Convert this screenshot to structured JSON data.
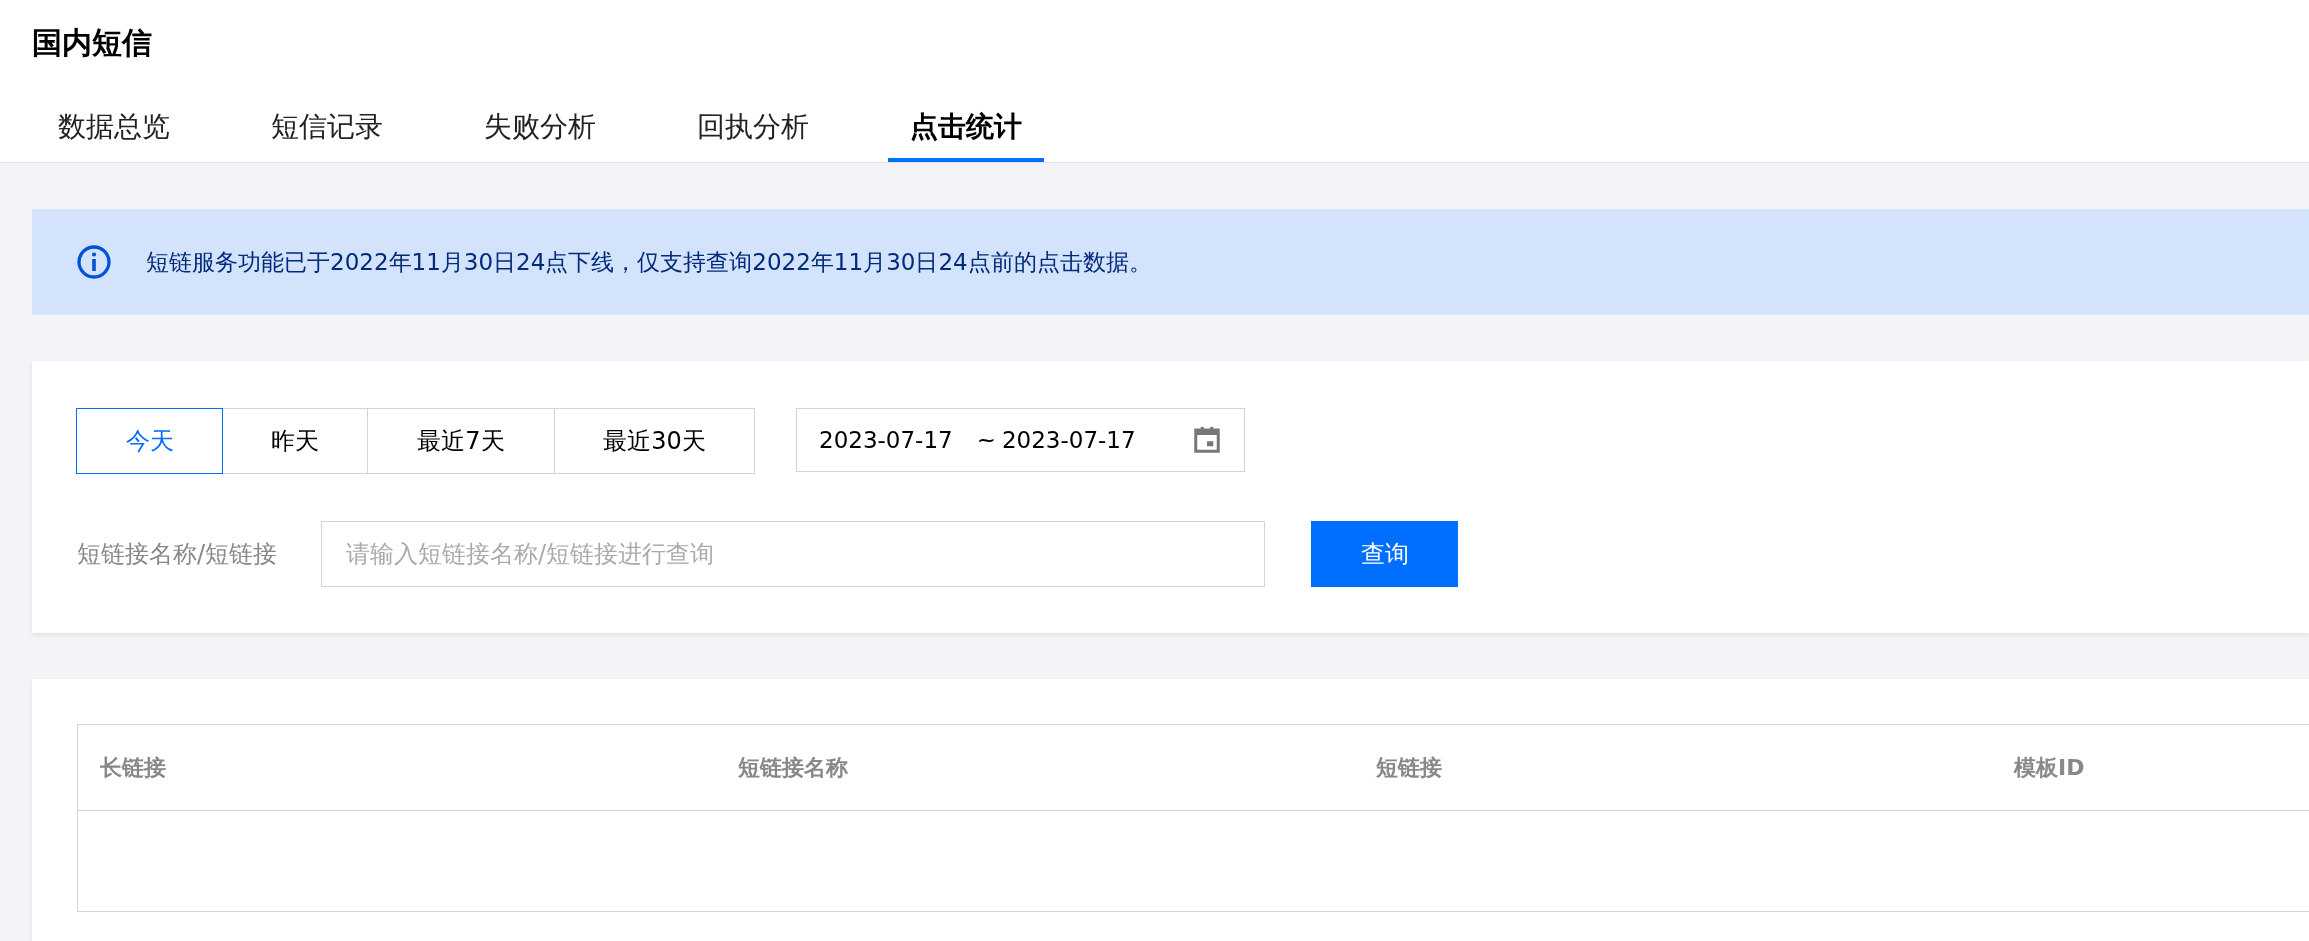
{
  "page": {
    "title": "国内短信"
  },
  "tabs": [
    {
      "label": "数据总览",
      "selected": false
    },
    {
      "label": "短信记录",
      "selected": false
    },
    {
      "label": "失败分析",
      "selected": false
    },
    {
      "label": "回执分析",
      "selected": false
    },
    {
      "label": "点击统计",
      "selected": true
    }
  ],
  "notice": {
    "text": "短链服务功能已于2022年11月30日24点下线，仅支持查询2022年11月30日24点前的点击数据。"
  },
  "filters": {
    "range_buttons": [
      {
        "label": "今天",
        "selected": true
      },
      {
        "label": "昨天",
        "selected": false
      },
      {
        "label": "最近7天",
        "selected": false
      },
      {
        "label": "最近30天",
        "selected": false
      }
    ],
    "date_range": {
      "start": "2023-07-17",
      "separator": "~",
      "end": "2023-07-17"
    },
    "search": {
      "label": "短链接名称/短链接",
      "placeholder": "请输入短链接名称/短链接进行查询"
    },
    "query_button": "查询"
  },
  "table": {
    "columns": [
      "长链接",
      "短链接名称",
      "短链接",
      "模板ID"
    ]
  }
}
